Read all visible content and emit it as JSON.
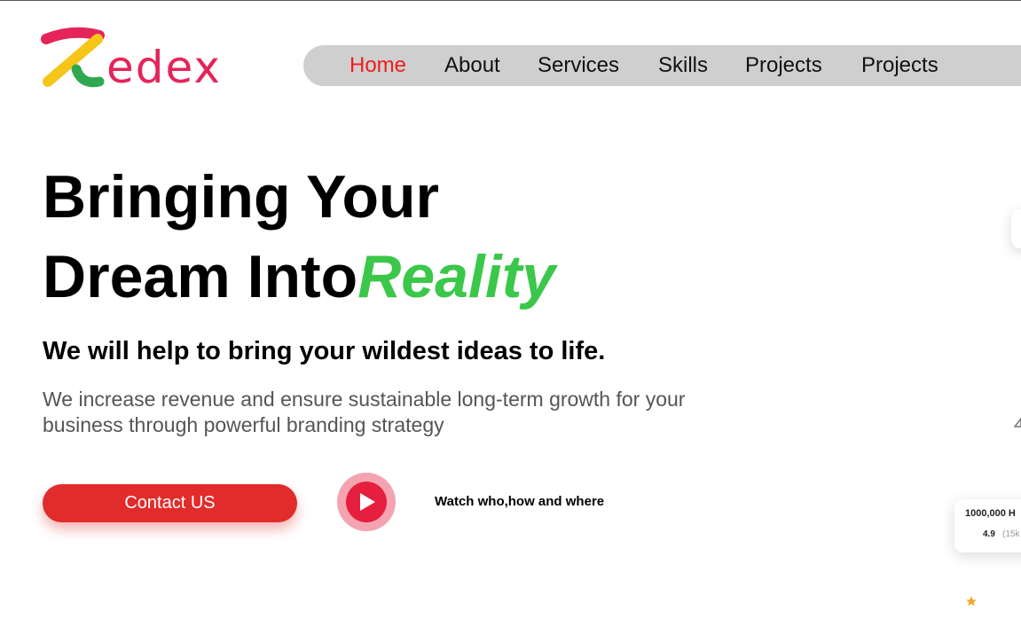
{
  "logo": {
    "text": "edex",
    "colors": {
      "red": "#e5245a",
      "yellow": "#f5c518",
      "green": "#2fa84f"
    }
  },
  "nav": {
    "items": [
      {
        "label": "Home",
        "active": true
      },
      {
        "label": "About",
        "active": false
      },
      {
        "label": "Services",
        "active": false
      },
      {
        "label": "Skills",
        "active": false
      },
      {
        "label": "Projects",
        "active": false
      },
      {
        "label": "Projects",
        "active": false
      }
    ]
  },
  "hero": {
    "line1": "Bringing Your",
    "line2_prefix": "Dream Into",
    "line2_accent": "Reality",
    "subtitle": "We will help to bring your wildest ideas to life.",
    "description": "We increase revenue and ensure sustainable long-term growth for your business through powerful branding strategy"
  },
  "cta": {
    "contact_label": "Contact US",
    "watch_text": "Watch who,how and where",
    "play_icon": "play-icon"
  },
  "stat_card": {
    "title": "1000,000 H",
    "rating": "4.9",
    "reviews": "(15k"
  },
  "colors": {
    "accent_green": "#3bc74a",
    "primary_red": "#e22b2b",
    "nav_active": "#ef1d1d",
    "nav_bg": "#cfcfcf",
    "star": "#f5a623"
  }
}
